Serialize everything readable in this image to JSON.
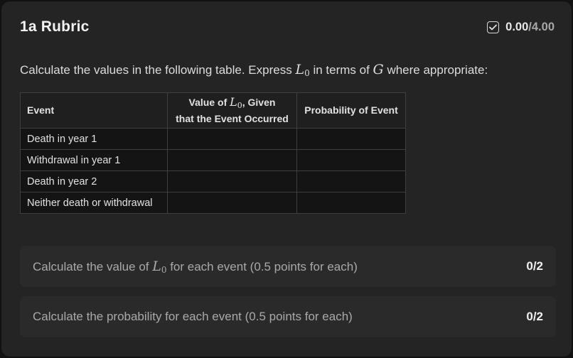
{
  "rubric": {
    "title": "1a Rubric",
    "score_value": "0.00",
    "score_max": "/4.00"
  },
  "prompt": {
    "before": "Calculate the values in the following table. Express ",
    "var": "L",
    "sub": "0",
    "middle": " in terms of ",
    "var2": "G",
    "after": " where appropriate:"
  },
  "table": {
    "headers": {
      "event": "Event",
      "value_pre": "Value of ",
      "value_var": "L",
      "value_sub": "0",
      "value_post": ", Given",
      "value_line2": "that the Event Occurred",
      "probability": "Probability of Event"
    },
    "rows": [
      {
        "event": "Death in year 1",
        "value": "",
        "probability": ""
      },
      {
        "event": "Withdrawal in year 1",
        "value": "",
        "probability": ""
      },
      {
        "event": "Death in year 2",
        "value": "",
        "probability": ""
      },
      {
        "event": "Neither death or withdrawal",
        "value": "",
        "probability": ""
      }
    ]
  },
  "criteria": [
    {
      "pre": "Calculate the value of ",
      "var": "L",
      "sub": "0",
      "post": " for each event (0.5 points for each)",
      "points": "0/2"
    },
    {
      "pre": "Calculate the probability for each event (0.5 points for each)",
      "var": "",
      "sub": "",
      "post": "",
      "points": "0/2"
    }
  ],
  "icons": {
    "score": "checkbox-check-icon"
  }
}
